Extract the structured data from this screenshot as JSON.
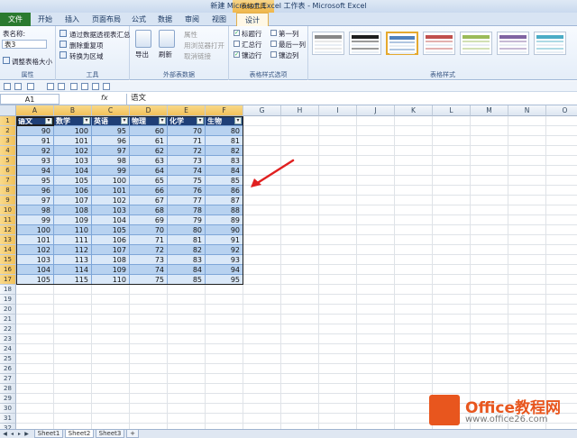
{
  "window": {
    "title": "新建 Microsoft Excel 工作表 - Microsoft Excel",
    "context_tools": "表格工具"
  },
  "tabs": [
    "文件",
    "开始",
    "插入",
    "页面布局",
    "公式",
    "数据",
    "审阅",
    "视图",
    "设计"
  ],
  "ribbon": {
    "properties": {
      "namebox_label": "表名称:",
      "table_name": "表3",
      "resize_label": "调整表格大小",
      "group_label": "属性"
    },
    "tools": {
      "items": [
        "通过数据透视表汇总",
        "删除重复项",
        "转换为区域"
      ],
      "group_label": "工具"
    },
    "external": {
      "export_label": "导出",
      "refresh_label": "刷新",
      "items": [
        "属性",
        "用浏览器打开",
        "取消链接"
      ],
      "group_label": "外部表数据"
    },
    "style_options": {
      "options": [
        {
          "label": "标题行",
          "checked": true
        },
        {
          "label": "汇总行",
          "checked": false
        },
        {
          "label": "镶边行",
          "checked": true
        },
        {
          "label": "第一列",
          "checked": false
        },
        {
          "label": "最后一列",
          "checked": false
        },
        {
          "label": "镶边列",
          "checked": false
        }
      ],
      "group_label": "表格样式选项"
    },
    "styles": {
      "group_label": "表格样式",
      "swatch_colors": [
        "#ffffff",
        "#1f1f1f",
        "#4f81bd",
        "#c0504d",
        "#9bbb59",
        "#8064a2",
        "#4bacc6"
      ]
    }
  },
  "formula_bar": {
    "cell_ref": "A1",
    "fx": "fx",
    "value": "语文"
  },
  "grid": {
    "columns": [
      "A",
      "B",
      "C",
      "D",
      "E",
      "F",
      "G",
      "H",
      "I",
      "J",
      "K",
      "L",
      "M",
      "N",
      "O"
    ],
    "row_count": 34
  },
  "table": {
    "headers": [
      "语文",
      "数学",
      "英语",
      "物理",
      "化学",
      "生物"
    ],
    "rows": [
      [
        90,
        100,
        95,
        60,
        70,
        80
      ],
      [
        91,
        101,
        96,
        61,
        71,
        81
      ],
      [
        92,
        102,
        97,
        62,
        72,
        82
      ],
      [
        93,
        103,
        98,
        63,
        73,
        83
      ],
      [
        94,
        104,
        99,
        64,
        74,
        84
      ],
      [
        95,
        105,
        100,
        65,
        75,
        85
      ],
      [
        96,
        106,
        101,
        66,
        76,
        86
      ],
      [
        97,
        107,
        102,
        67,
        77,
        87
      ],
      [
        98,
        108,
        103,
        68,
        78,
        88
      ],
      [
        99,
        109,
        104,
        69,
        79,
        89
      ],
      [
        100,
        110,
        105,
        70,
        80,
        90
      ],
      [
        101,
        111,
        106,
        71,
        81,
        91
      ],
      [
        102,
        112,
        107,
        72,
        82,
        92
      ],
      [
        103,
        113,
        108,
        73,
        83,
        93
      ],
      [
        104,
        114,
        109,
        74,
        84,
        94
      ],
      [
        105,
        115,
        110,
        75,
        85,
        95
      ]
    ],
    "header_color": "#1f3f77",
    "band_colors": [
      "#b8d2f0",
      "#dae8f8"
    ]
  },
  "sheets": {
    "tabs": [
      "Sheet1",
      "Sheet2",
      "Sheet3"
    ],
    "active": "Sheet2"
  },
  "annotation": {
    "arrow_color": "#e02020"
  },
  "watermark": {
    "brand": "Office教程网",
    "url": "www.office26.com"
  }
}
